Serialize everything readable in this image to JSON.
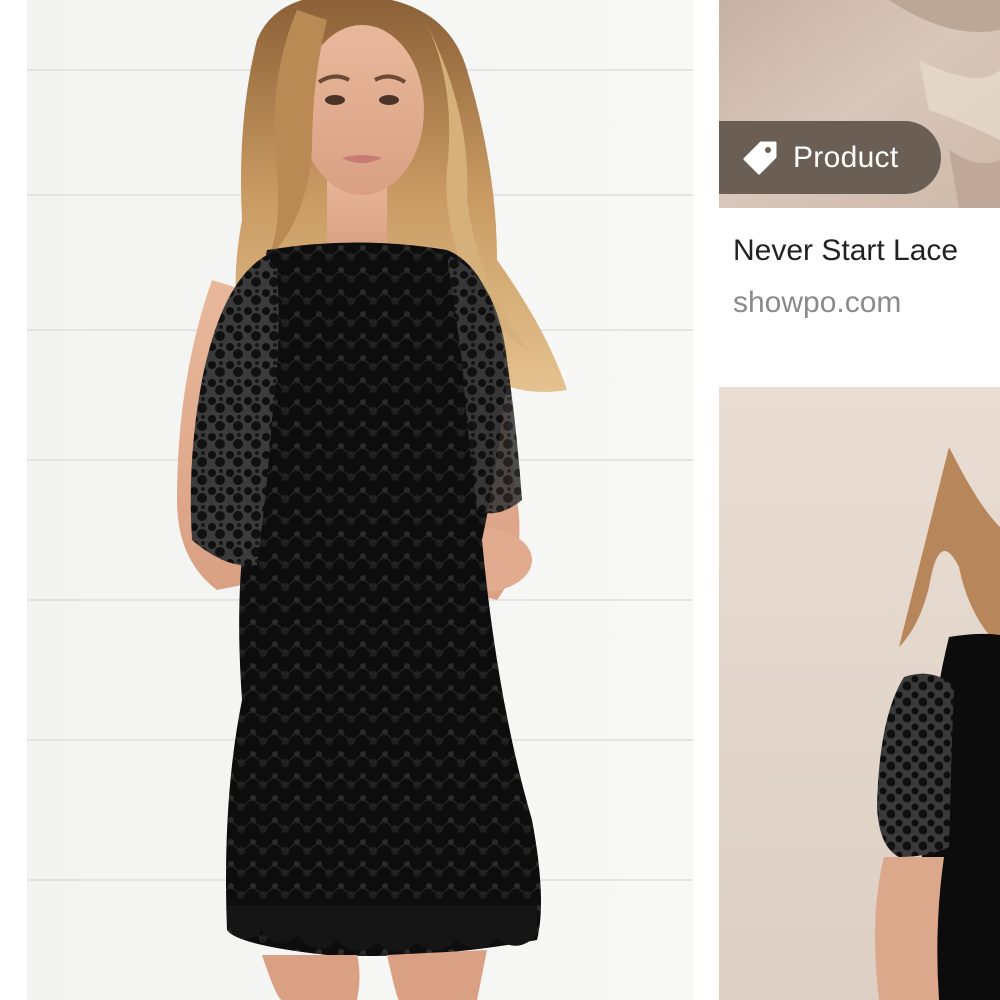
{
  "results": [
    {
      "image_alt": "Black lace dress model photo"
    },
    {
      "badge": {
        "label": "Product",
        "icon": "tag-icon"
      },
      "title": "Never Start Lace",
      "source": "showpo.com"
    },
    {
      "image_alt": "Black lace dress second model photo"
    }
  ],
  "colors": {
    "badge_bg": "#6a5e55",
    "title_text": "#222222",
    "source_text": "#8a8a8a"
  }
}
